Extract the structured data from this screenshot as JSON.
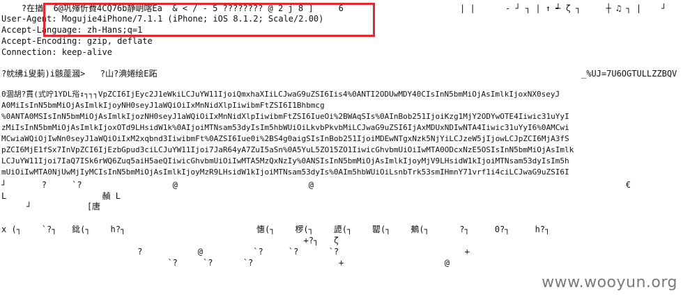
{
  "dump": {
    "garbled_top": "    ?在揂  6@巩殬忻費4CQ76b静岄喀Ea  & < / - 5 ???????? @ 2 j 8 ]     6",
    "garbled_top_right": "| |      - ┘ ┐ | ↑ ┵ ζ ┐     ┼ ♫ ┐ |    ┘",
    "headers": [
      "User-Agent: Mogujie4iPhone/7.1.1 (iPhone; iOS 8.1.2; Scale/2.00)",
      "Accept-Language: zh-Hans;q=1",
      "Accept-Encoding: gzip, deflate",
      "Connection: keep-alive"
    ],
    "garbled_mid": "?帎绋i叟莿)i骸蓙漍>   ?山?淟婘绘E跖",
    "garbled_mid_right": "_%UJ=7U6OGTULLZZBQV",
    "payload_lines": [
      "0涸胡?貫(式咛1YDL谸↕┐┐┐VpZCI6IjEyc2J1eWkiLCJuYW11IjoiQmxhaXIiLCJwaG9uZSI6Iis4%0ANTI2ODUwMDY40CIsInN5bmMiOjAsImlkIjoxNX0seyJ",
      "A0MiIsInN5bmMiOjAsImlkIjoyNH0seyJ1aWQiOiIxMnNidXlpIiwibmFtZSI6I1Bhbmcg",
      "%0ANTA0MSIsInN5bmMiOjAsImlkIjozNH0seyJ1aWQiOiIxMnNidXlpIiwibmFtZSI6IueOi%2BWAqSIs%0AInBob251IjoiKzg1MjY2ODYwOTE4Iiwic31uYyI",
      "zMiIsInN5bmMiOjAsImlkIjoxOTd9LHsidW1k%0AIjoiMTNsam53dyIsIm5hbWUiOiLkvbPkvbMiLCJwaG9uZSI6IjAxMDUxNDIwNTA4Iiwic31uYyI6%0AMCwi",
      "MCwiaWQiOjIwNn0seyJ1aWQiOiIxM2xqbnd3IiwibmFt%0AZSI6Iue0i%2BS4g0aigSIsInBob251IjoiMDEwNTgxNzk5NjYiLCJzeW5jIjowLCJpZCI6MjA3fS",
      "pZCI6MjE1fSx7InVpZCI6IjEzbGpud3ciLCJuYW11Ijoi7JaR64yA7ZuI5aSn%0A5YuL5ZO15ZO1IiwicGhvbmUiOiIwMTA0ODcxNzE5OSIsInN5bmMiOjAsImlk",
      "LCJuYW11Ijoi7IaQ7ISk6rWQ6Zuq5aiH5aeQIiwicGhvbmUiOiIwMTA5MzQxNzIy%0ANSIsInN5bmMiOjAsImlkIjoyMjV9LHsidW1kIjoiMTNsam53dyIsIm5h",
      "mUiOiIwMTA0NjUwMjIyMCIsInN5bmMiOjAsImlkIjoyMzR9LHsidW1kIjoiMTNsam53dyIs%0AIm5hbWUiOiLsnbTrk53smIHmnY71vrf1i4ciLCJwaG9uZSI6I"
    ],
    "garbled_tail_row1": "┘       ?     `?                  @                          @                                                              €",
    "garbled_tail_row2": "L                   赬 L",
    "garbled_tail_row3": "     ┘           [唐",
    "garbled_tail_row4": "x (┐    `?┐   鉳(┐    h?┐                          憓(┐    椤(┐    頾(┐    罌(┐    鴺(┐      ?┐     0?┐     h?┐",
    "garbled_tail_row5": "                                                            +?┐   ζ",
    "garbled_tail_row6": "                           ?           @          `?     `?      `?                         +",
    "garbled_tail_row7": "                                 `?     `?      `?                 +                    @"
  },
  "watermark": "www.wooyun.org",
  "colors": {
    "highlight": "#e8262b",
    "watermark": "#7a7a7a"
  }
}
